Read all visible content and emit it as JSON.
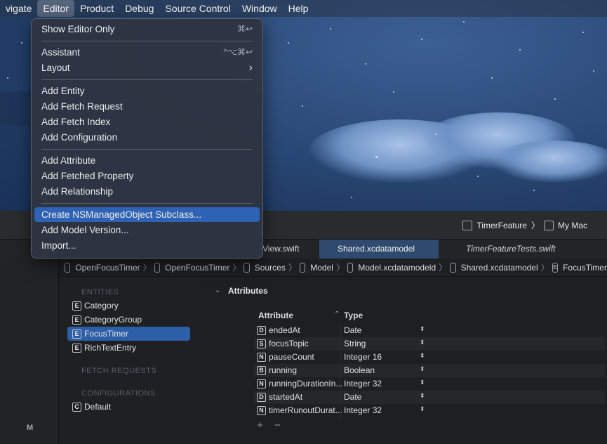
{
  "menubar": {
    "items": [
      "vigate",
      "Editor",
      "Product",
      "Debug",
      "Source Control",
      "Window",
      "Help"
    ],
    "active_index": 1
  },
  "editor_menu": {
    "items": [
      {
        "label": "Show Editor Only",
        "shortcut": "⌘↩"
      },
      {
        "label": "Assistant",
        "shortcut": "^⌥⌘↩"
      },
      {
        "label": "Layout",
        "shortcut": "›"
      },
      {
        "label": "Add Entity",
        "shortcut": ""
      },
      {
        "label": "Add Fetch Request",
        "shortcut": ""
      },
      {
        "label": "Add Fetch Index",
        "shortcut": ""
      },
      {
        "label": "Add Configuration",
        "shortcut": ""
      },
      {
        "label": "Add Attribute",
        "shortcut": ""
      },
      {
        "label": "Add Fetched Property",
        "shortcut": ""
      },
      {
        "label": "Add Relationship",
        "shortcut": ""
      },
      {
        "label": "Create NSManagedObject Subclass...",
        "shortcut": ""
      },
      {
        "label": "Add Model Version...",
        "shortcut": ""
      },
      {
        "label": "Import...",
        "shortcut": ""
      }
    ],
    "highlighted_index": 10
  },
  "toolbar": {
    "scheme": "TimerFeature",
    "separator": "〉",
    "destination": "My Mac"
  },
  "tabs": {
    "view_tab": "rView.swift",
    "shared_tab": "Shared.xcdatamodel",
    "tests_tab": "TimerFeatureTests.swift"
  },
  "jumpbar": {
    "crumbs": [
      "OpenFocusTimer",
      "OpenFocusTimer",
      "Sources",
      "Model",
      "Model.xcdatamodeld",
      "Shared.xcdatamodel",
      "FocusTimer"
    ]
  },
  "navigator": {
    "entities_header": "ENTITIES",
    "entities": [
      {
        "badge": "E",
        "name": "Category"
      },
      {
        "badge": "E",
        "name": "CategoryGroup"
      },
      {
        "badge": "E",
        "name": "FocusTimer"
      },
      {
        "badge": "E",
        "name": "RichTextEntry"
      }
    ],
    "selected_index": 2,
    "fetch_header": "FETCH REQUESTS",
    "config_header": "CONFIGURATIONS",
    "configurations": [
      {
        "badge": "C",
        "name": "Default"
      }
    ]
  },
  "left_strip_letter": "M",
  "attributes": {
    "section_title": "Attributes",
    "col_attribute": "Attribute",
    "col_type": "Type",
    "sort_indicator": "⌃",
    "rows": [
      {
        "badge": "D",
        "name": "endedAt",
        "type": "Date"
      },
      {
        "badge": "S",
        "name": "focusTopic",
        "type": "String"
      },
      {
        "badge": "N",
        "name": "pauseCount",
        "type": "Integer 16"
      },
      {
        "badge": "B",
        "name": "running",
        "type": "Boolean"
      },
      {
        "badge": "N",
        "name": "runningDurationIn...",
        "type": "Integer 32"
      },
      {
        "badge": "D",
        "name": "startedAt",
        "type": "Date"
      },
      {
        "badge": "N",
        "name": "timerRunoutDurat...",
        "type": "Integer 32"
      }
    ],
    "add_label": "+",
    "remove_label": "−"
  }
}
